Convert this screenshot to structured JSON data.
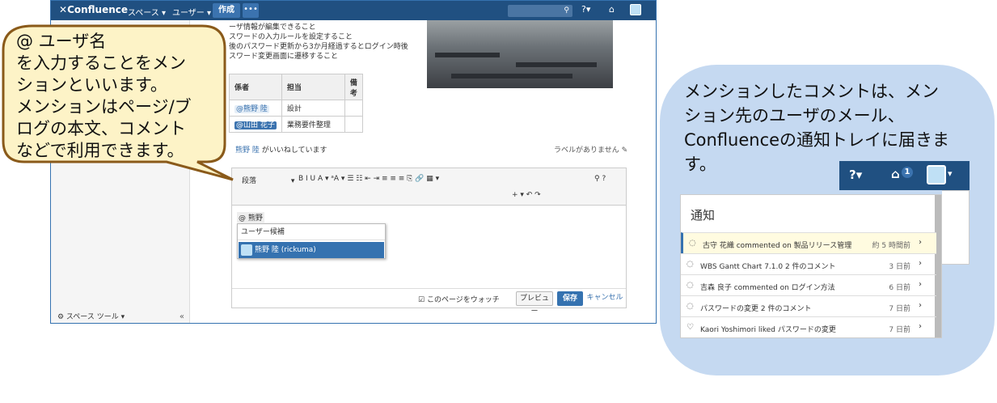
{
  "topbar": {
    "logo": "Confluence",
    "nav_spaces": "スペース ▾",
    "nav_users": "ユーザー ▾",
    "create": "作成",
    "more": "•••",
    "search_icon": "⚲",
    "help_icon": "?▾",
    "tray_icon": "⌂"
  },
  "page": {
    "body_lines": [
      "ーザ情報が編集できること",
      "スワードの入力ルールを設定すること",
      "後のパスワード更新から3か月経過するとログイン時後",
      "スワード変更画面に遷移すること"
    ],
    "table": {
      "headers": [
        "係者",
        "担当",
        "備考"
      ],
      "rows": [
        {
          "person": "@熊野 陸",
          "role": "設計"
        },
        {
          "person": "@山田 花子",
          "role": "業務要件整理"
        }
      ]
    },
    "like_name": "熊野 陸",
    "like_suffix": " がいいねしています",
    "labels": "ラベルがありません"
  },
  "editor": {
    "toolbar_paragraph": "段落",
    "toolbar_row1": "B  I  U  A ▾  ᵃA ▾   ☰  ☷   ⇤  ⇥   ≡  ≡  ≡   ⎘  🔗  ▦ ▾",
    "toolbar_row2": "+ ▾   ↶  ↷",
    "toolbar_search": "⚲   ?",
    "typed_text": "@ 熊野",
    "suggest_header": "ユーザー候補",
    "suggest_item": "熊野 陸 (rickuma)",
    "watch_label": "このページをウォッチ",
    "preview": "プレビュー",
    "save": "保存",
    "cancel": "キャンセル"
  },
  "sidebar": {
    "space_tools": "⚙ スペース ツール ▾",
    "collapse": "«"
  },
  "callout_left": {
    "lines": [
      "@ ユーザ名",
      "を入力することをメン",
      "ションといいます。",
      "メンションはページ/ブ",
      "ログの本文、コメント",
      "などで利用できます。"
    ]
  },
  "callout_right": {
    "lines": [
      "メンションしたコメントは、メン",
      "ション先のユーザのメール、",
      "Confluenceの通知トレイに届きま",
      "す。"
    ]
  },
  "notif_header": {
    "help": "?▾",
    "badge": "1",
    "chevron": "▾"
  },
  "notifications": {
    "title": "通知",
    "items": [
      {
        "icon": "💬",
        "text": "古守 花織 commented on 製品リリース管理",
        "time": "約 5 時間前"
      },
      {
        "icon": "💬",
        "text": "WBS Gantt Chart 7.1.0 2 件のコメント",
        "time": "3 日前"
      },
      {
        "icon": "💬",
        "text": "吉森 良子 commented on ログイン方法",
        "time": "6 日前"
      },
      {
        "icon": "💬",
        "text": "パスワードの変更 2 件のコメント",
        "time": "7 日前"
      },
      {
        "icon": "👍",
        "text": "Kaori Yoshimori liked パスワードの変更",
        "time": "7 日前"
      }
    ]
  },
  "colors": {
    "topbar": "#205081",
    "accent": "#3572b0",
    "callout_left_fill": "#fdf3c7",
    "callout_left_border": "#8a5a1a",
    "callout_right_fill": "#c5d9f1"
  }
}
